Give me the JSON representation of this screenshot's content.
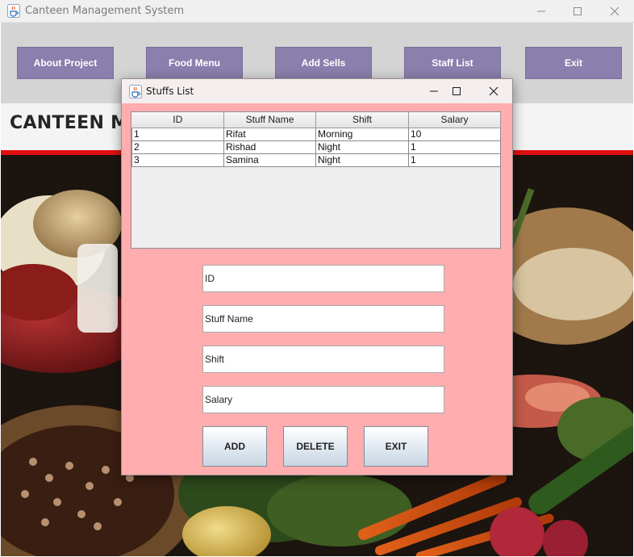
{
  "main_window": {
    "title": "Canteen Management System",
    "icon": "java-cup-icon",
    "nav": [
      {
        "label": "About Project"
      },
      {
        "label": "Food Menu"
      },
      {
        "label": "Add Sells"
      },
      {
        "label": "Staff List"
      },
      {
        "label": "Exit"
      }
    ],
    "heading": "CANTEEN MA",
    "accent_color": "#e01010",
    "nav_color": "#8b7fad"
  },
  "dialog": {
    "title": "Stuffs List",
    "icon": "java-cup-icon",
    "background_color": "#ffadaf",
    "table": {
      "headers": [
        "ID",
        "Stuff Name",
        "Shift",
        "Salary"
      ],
      "rows": [
        [
          "1",
          "Rifat",
          "Morning",
          "10"
        ],
        [
          "2",
          "Rishad",
          "Night",
          "1"
        ],
        [
          "3",
          "Samina",
          "Night",
          "1"
        ]
      ]
    },
    "fields": {
      "id": "ID",
      "name": "Stuff Name",
      "shift": "Shift",
      "salary": "Salary"
    },
    "buttons": {
      "add": "ADD",
      "delete": "DELETE",
      "exit": "EXIT"
    }
  }
}
